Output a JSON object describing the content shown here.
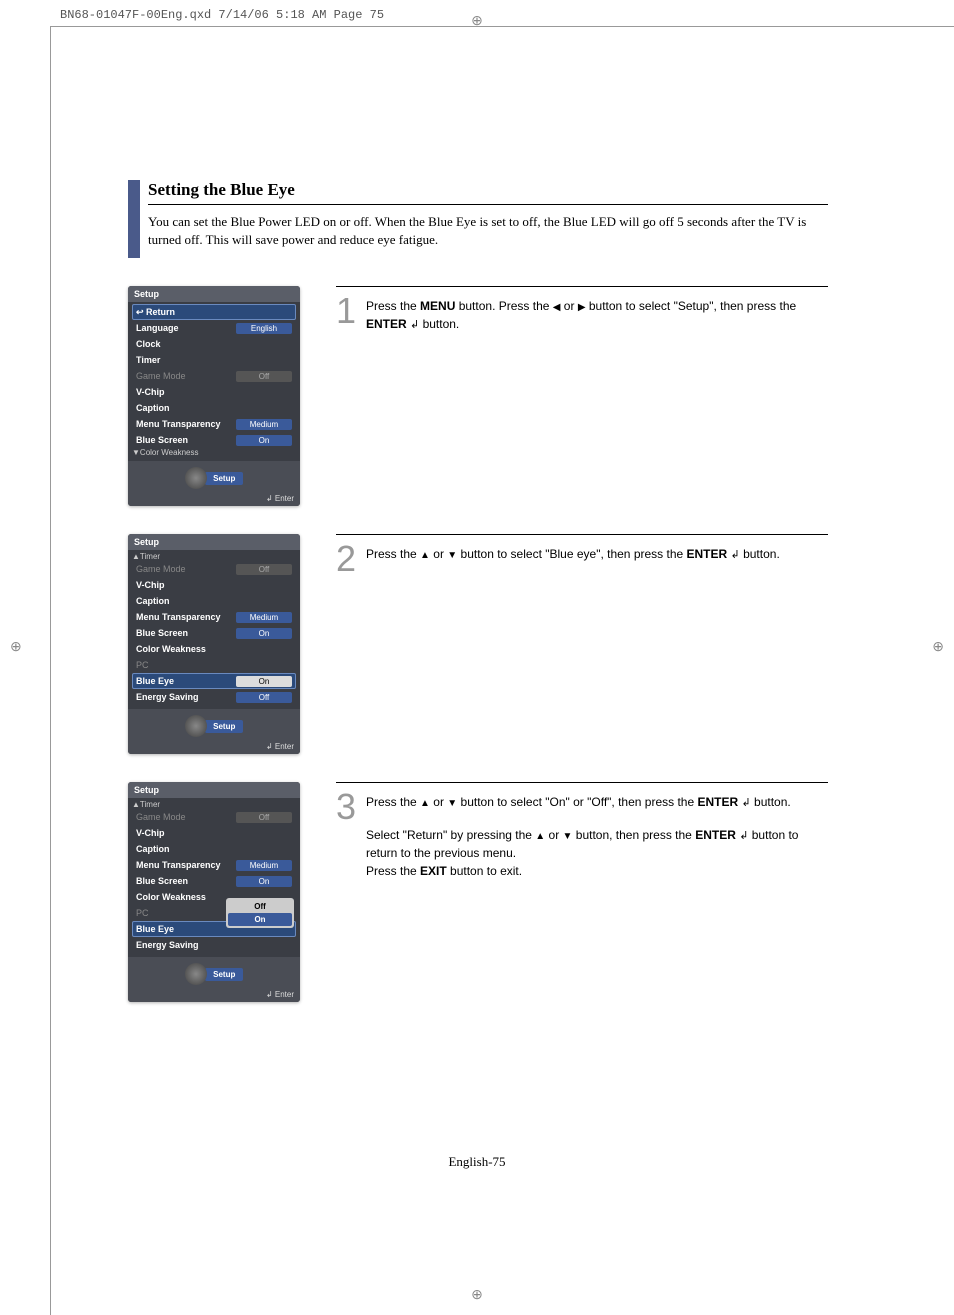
{
  "print_header": "BN68-01047F-00Eng.qxd  7/14/06  5:18 AM  Page 75",
  "section": {
    "title": "Setting the Blue Eye",
    "intro": "You can set the Blue Power LED on or off. When the Blue Eye is set to off, the Blue LED will go off 5 seconds after the TV is turned off. This will save power and reduce eye fatigue."
  },
  "steps": {
    "s1": {
      "num": "1",
      "para": "Press the MENU button. Press the ◀ or ▶ button to select \"Setup\", then press  the ENTER ↲ button."
    },
    "s2": {
      "num": "2",
      "para": "Press the ▲ or ▼ button to select \"Blue eye\", then press the ENTER ↲ button."
    },
    "s3": {
      "num": "3",
      "p1": "Press the ▲ or ▼ button to select \"On\" or \"Off\", then press the ENTER ↲ button.",
      "p2": "Select \"Return\" by pressing the ▲ or ▼ button, then press the ENTER ↲ button to return to the previous menu.",
      "p3": "Press the EXIT button to exit."
    }
  },
  "osd1": {
    "title": "Setup",
    "return": "↩ Return",
    "items": [
      {
        "label": "Language",
        "value": "English",
        "dim": false,
        "vblue": true
      },
      {
        "label": "Clock",
        "value": "",
        "dim": false
      },
      {
        "label": "Timer",
        "value": "",
        "dim": false
      },
      {
        "label": "Game Mode",
        "value": "Off",
        "dim": true
      },
      {
        "label": "V-Chip",
        "value": "",
        "dim": false
      },
      {
        "label": "Caption",
        "value": "",
        "dim": false
      },
      {
        "label": "Menu Transparency",
        "value": "Medium",
        "dim": false,
        "vblue": true
      },
      {
        "label": "Blue Screen",
        "value": "On",
        "dim": false,
        "vblue": true
      }
    ],
    "scroll": "▼Color Weakness",
    "footer_label": "Setup",
    "bottom": "↲ Enter"
  },
  "osd2": {
    "title": "Setup",
    "scroll_up": "▲Timer",
    "items": [
      {
        "label": "Game Mode",
        "value": "Off",
        "dim": true
      },
      {
        "label": "V-Chip",
        "value": "",
        "dim": false
      },
      {
        "label": "Caption",
        "value": "",
        "dim": false
      },
      {
        "label": "Menu Transparency",
        "value": "Medium",
        "dim": false,
        "vblue": true
      },
      {
        "label": "Blue Screen",
        "value": "On",
        "dim": false,
        "vblue": true
      },
      {
        "label": "Color Weakness",
        "value": "",
        "dim": false
      },
      {
        "label": "PC",
        "value": "",
        "dim": true
      },
      {
        "label": "Blue Eye",
        "value": "On",
        "dim": false,
        "selected": true
      },
      {
        "label": "Energy Saving",
        "value": "Off",
        "dim": false,
        "vblue": true
      }
    ],
    "footer_label": "Setup",
    "bottom": "↲ Enter"
  },
  "osd3": {
    "title": "Setup",
    "scroll_up": "▲Timer",
    "items": [
      {
        "label": "Game Mode",
        "value": "Off",
        "dim": true
      },
      {
        "label": "V-Chip",
        "value": "",
        "dim": false
      },
      {
        "label": "Caption",
        "value": "",
        "dim": false
      },
      {
        "label": "Menu Transparency",
        "value": "Medium",
        "dim": false,
        "vblue": true
      },
      {
        "label": "Blue Screen",
        "value": "On",
        "dim": false,
        "vblue": true
      },
      {
        "label": "Color Weakness",
        "value": "",
        "dim": false
      },
      {
        "label": "PC",
        "value": "",
        "dim": true
      },
      {
        "label": "Blue Eye",
        "value": "",
        "dim": false,
        "selected": true
      },
      {
        "label": "Energy Saving",
        "value": "",
        "dim": false
      }
    ],
    "popup": {
      "opt_off": "Off",
      "opt_on": "On"
    },
    "footer_label": "Setup",
    "bottom": "↲ Enter"
  },
  "footer": "English-75"
}
